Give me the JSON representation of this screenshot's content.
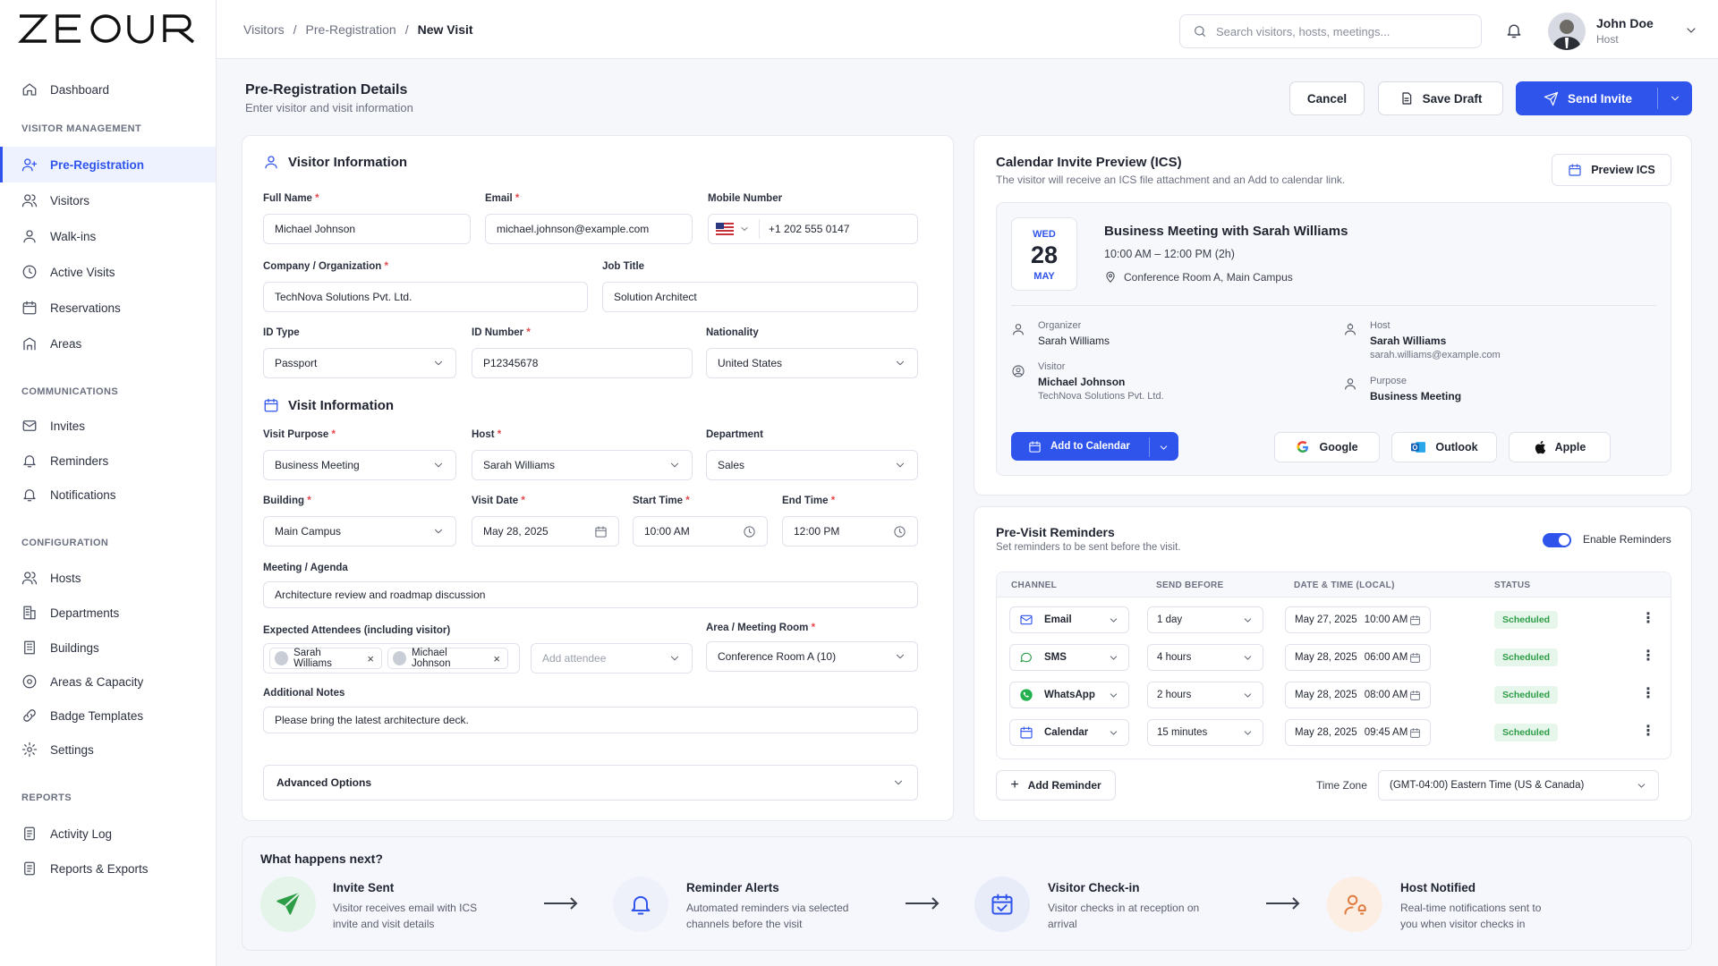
{
  "brand": {
    "logo_text": "ZEOUR",
    "accent": "#2f54eb"
  },
  "sidebar": {
    "dashboard": "Dashboard",
    "sections": [
      "VISITOR MANAGEMENT",
      "COMMUNICATIONS",
      "CONFIGURATION",
      "REPORTS"
    ],
    "visitor_management": [
      "Pre-Registration",
      "Visitors",
      "Walk-ins",
      "Active Visits",
      "Reservations",
      "Areas"
    ],
    "communications": [
      "Invites",
      "Reminders",
      "Notifications"
    ],
    "configuration": [
      "Hosts",
      "Departments",
      "Buildings",
      "Areas & Capacity",
      "Badge Templates",
      "Settings"
    ],
    "reports": [
      "Activity Log",
      "Reports & Exports"
    ]
  },
  "header": {
    "breadcrumbs": [
      "Visitors",
      "Pre-Registration",
      "New Visit"
    ],
    "search_placeholder": "Search visitors, hosts, meetings...",
    "user_name": "John Doe",
    "user_role": "Host"
  },
  "page": {
    "title": "Pre-Registration Details",
    "subtitle": "Enter visitor and visit information",
    "cancel": "Cancel",
    "save_draft": "Save Draft",
    "send_invite": "Send Invite"
  },
  "visitor": {
    "title": "Visitor Information",
    "full_name_label": "Full Name",
    "full_name": "Michael Johnson",
    "email_label": "Email",
    "email": "michael.johnson@example.com",
    "mobile_label": "Mobile Number",
    "mobile": "+1 202 555 0147",
    "company_label": "Company / Organization",
    "company": "TechNova Solutions Pvt. Ltd.",
    "job_label": "Job Title",
    "job": "Solution Architect",
    "id_type_label": "ID Type",
    "id_type": "Passport",
    "id_number_label": "ID Number",
    "id_number": "P12345678",
    "nationality_label": "Nationality",
    "nationality": "United States"
  },
  "visit": {
    "title": "Visit Information",
    "purpose_label": "Visit Purpose",
    "purpose": "Business Meeting",
    "host_label": "Host",
    "host": "Sarah Williams",
    "department_label": "Department",
    "department": "Sales",
    "building_label": "Building",
    "building": "Main Campus",
    "date_label": "Visit Date",
    "date": "May 28, 2025",
    "start_label": "Start Time",
    "start": "10:00 AM",
    "end_label": "End Time",
    "end": "12:00 PM",
    "agenda_label": "Meeting / Agenda",
    "agenda": "Architecture review and roadmap discussion",
    "attendees_label": "Expected Attendees (including visitor)",
    "attendees": [
      "Sarah Williams",
      "Michael Johnson"
    ],
    "add_attendee": "Add attendee",
    "area_label": "Area / Meeting Room",
    "area": "Conference Room A  (10)",
    "notes_label": "Additional Notes",
    "notes": "Please bring the latest architecture deck.",
    "advanced": "Advanced Options"
  },
  "calendar": {
    "title": "Calendar Invite Preview (ICS)",
    "subtitle": "The visitor will receive an ICS file attachment and an Add to calendar link.",
    "preview_btn": "Preview ICS",
    "day": "WED",
    "date_num": "28",
    "month": "MAY",
    "event_title": "Business Meeting with Sarah Williams",
    "time": "10:00 AM – 12:00 PM (2h)",
    "location": "Conference Room A, Main Campus",
    "organizer_label": "Organizer",
    "organizer": "Sarah Williams",
    "host_label": "Host",
    "host": "Sarah Williams",
    "host_email": "sarah.williams@example.com",
    "visitor_label": "Visitor",
    "visitor": "Michael Johnson",
    "visitor_company": "TechNova Solutions Pvt. Ltd.",
    "purpose_label": "Purpose",
    "purpose": "Business Meeting",
    "add_btn": "Add to Calendar",
    "google": "Google",
    "outlook": "Outlook",
    "apple": "Apple"
  },
  "reminders": {
    "title": "Pre-Visit Reminders",
    "subtitle": "Set reminders to be sent before the visit.",
    "enable_label": "Enable Reminders",
    "columns": [
      "CHANNEL",
      "SEND BEFORE",
      "DATE & TIME (LOCAL)",
      "STATUS"
    ],
    "rows": [
      {
        "channel": "Email",
        "before": "1 day",
        "date": "May 27, 2025",
        "time": "10:00 AM",
        "status": "Scheduled"
      },
      {
        "channel": "SMS",
        "before": "4 hours",
        "date": "May 28, 2025",
        "time": "06:00 AM",
        "status": "Scheduled"
      },
      {
        "channel": "WhatsApp",
        "before": "2 hours",
        "date": "May 28, 2025",
        "time": "08:00 AM",
        "status": "Scheduled"
      },
      {
        "channel": "Calendar",
        "before": "15 minutes",
        "date": "May 28, 2025",
        "time": "09:45 AM",
        "status": "Scheduled"
      }
    ],
    "add_btn": "Add Reminder",
    "tz_label": "Time Zone",
    "tz": "(GMT-04:00) Eastern Time (US & Canada)"
  },
  "next": {
    "title": "What happens next?",
    "steps": [
      {
        "title": "Invite Sent",
        "desc": "Visitor receives email with ICS invite and visit details"
      },
      {
        "title": "Reminder Alerts",
        "desc": "Automated reminders via selected channels before the visit"
      },
      {
        "title": "Visitor Check-in",
        "desc": "Visitor checks in at reception on arrival"
      },
      {
        "title": "Host Notified",
        "desc": "Real-time notifications sent to you when visitor checks in"
      }
    ]
  }
}
